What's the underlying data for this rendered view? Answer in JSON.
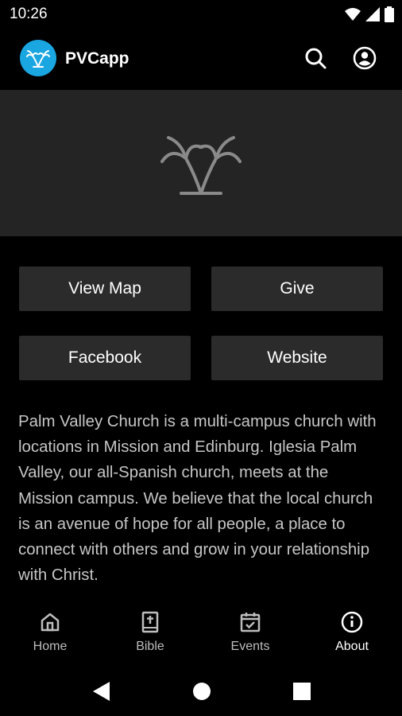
{
  "status_bar": {
    "time": "10:26",
    "icons": [
      "wifi-icon",
      "signal-icon",
      "battery-icon"
    ]
  },
  "app_bar": {
    "title": "PVCapp",
    "logo_color": "#1aa6e0",
    "actions": [
      "search-icon",
      "account-icon"
    ]
  },
  "hero": {
    "image": "palm-trees-logo"
  },
  "buttons": {
    "view_map": "View Map",
    "give": "Give",
    "facebook": "Facebook",
    "website": "Website"
  },
  "description": "Palm Valley Church is a multi-campus church with locations in Mission and Edinburg. Iglesia Palm Valley, our all-Spanish church, meets at the Mission campus. We believe that the local church is an avenue of hope for all people, a place to connect with others and grow in your relationship with Christ.",
  "bottom_nav": {
    "items": [
      {
        "label": "Home",
        "icon": "home-icon"
      },
      {
        "label": "Bible",
        "icon": "bible-icon"
      },
      {
        "label": "Events",
        "icon": "calendar-icon"
      },
      {
        "label": "About",
        "icon": "info-icon",
        "active": true
      }
    ]
  },
  "system_nav": [
    "back-icon",
    "home-circle-icon",
    "recents-icon"
  ]
}
